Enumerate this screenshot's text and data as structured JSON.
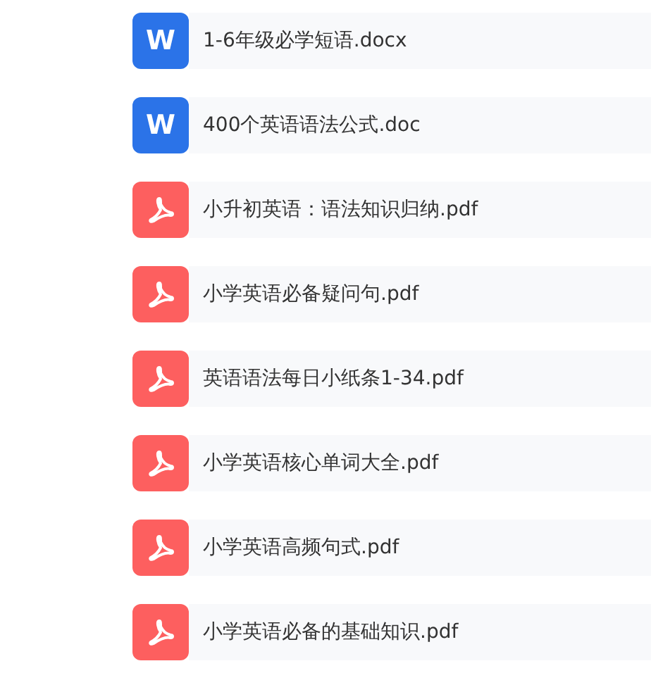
{
  "files": [
    {
      "kind": "word",
      "badge": "W",
      "name": "1-6年级必学短语.docx"
    },
    {
      "kind": "word",
      "badge": "W",
      "name": "400个英语语法公式.doc"
    },
    {
      "kind": "pdf",
      "name": "小升初英语：语法知识归纳.pdf"
    },
    {
      "kind": "pdf",
      "name": "小学英语必备疑问句.pdf"
    },
    {
      "kind": "pdf",
      "name": "英语语法每日小纸条1-34.pdf"
    },
    {
      "kind": "pdf",
      "name": "小学英语核心单词大全.pdf"
    },
    {
      "kind": "pdf",
      "name": "小学英语高频句式.pdf"
    },
    {
      "kind": "pdf",
      "name": "小学英语必备的基础知识.pdf"
    }
  ]
}
